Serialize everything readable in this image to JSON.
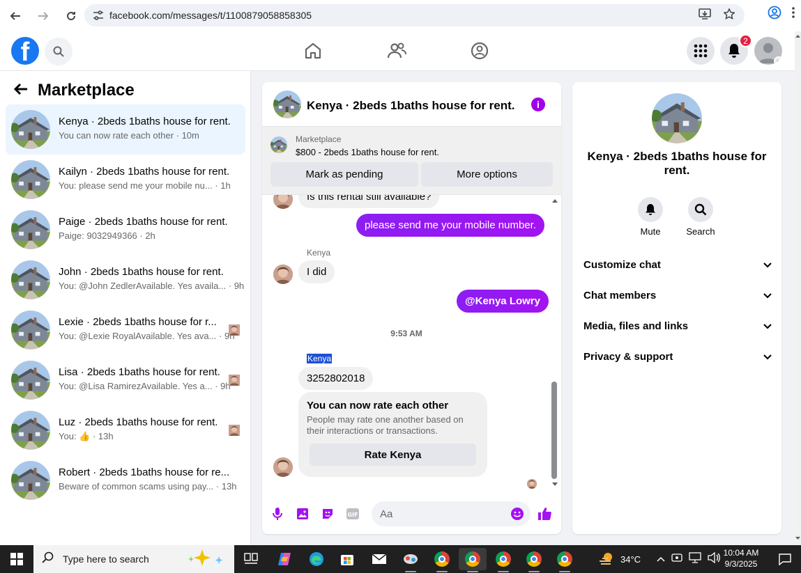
{
  "browser": {
    "url": "facebook.com/messages/t/1100879058858305"
  },
  "fb": {
    "notifications_count": "2"
  },
  "left": {
    "title": "Marketplace",
    "conversations": [
      {
        "name": "Kenya · 2beds 1baths house for rent.",
        "sub": "You can now rate each other · 10m"
      },
      {
        "name": "Kailyn · 2beds 1baths house for rent.",
        "sub": "You: please send me your mobile nu...  · 1h"
      },
      {
        "name": "Paige · 2beds 1baths house for rent.",
        "sub": "Paige: 9032949366 · 2h"
      },
      {
        "name": "John · 2beds 1baths house for rent.",
        "sub": "You: @John ZedlerAvailable. Yes availa... · 9h"
      },
      {
        "name": "Lexie · 2beds 1baths house for r...",
        "sub": "You: @Lexie RoyalAvailable. Yes ava... · 9h"
      },
      {
        "name": "Lisa · 2beds 1baths house for rent.",
        "sub": "You: @Lisa RamirezAvailable. Yes a... · 9h"
      },
      {
        "name": "Luz · 2beds 1baths house for rent.",
        "sub": "You: 👍 · 13h"
      },
      {
        "name": "Robert · 2beds 1baths house for re...",
        "sub": "Beware of common scams using pay... · 13h"
      }
    ]
  },
  "chat": {
    "title": "Kenya · 2beds 1baths house for rent.",
    "listing_label": "Marketplace",
    "listing_price": "$800 - 2beds 1baths house for rent.",
    "mark_pending": "Mark as pending",
    "more_options": "More options",
    "msg_partial": "Is this rental still available?",
    "msg_out_1": "please send me your mobile number.",
    "sender_1": "Kenya",
    "msg_in_1": "I did",
    "msg_out_2": "@Kenya Lowry",
    "timestamp": "9:53 AM",
    "sender_2": "Kenya",
    "msg_in_2": "3252802018",
    "rate_title": "You can now rate each other",
    "rate_desc": "People may rate one another based on their interactions or transactions.",
    "rate_button": "Rate Kenya",
    "input_placeholder": "Aa"
  },
  "info": {
    "title": "Kenya · 2beds 1baths house for rent.",
    "mute": "Mute",
    "search": "Search",
    "sections": [
      "Customize chat",
      "Chat members",
      "Media, files and links",
      "Privacy & support"
    ]
  },
  "taskbar": {
    "search_placeholder": "Type here to search",
    "temperature": "34°C",
    "time": "10:04 AM",
    "date": "9/3/2025"
  },
  "colors": {
    "fb_blue": "#1877f2",
    "messenger_purple": "#a213f0",
    "active_conv_bg": "#ebf5ff"
  }
}
